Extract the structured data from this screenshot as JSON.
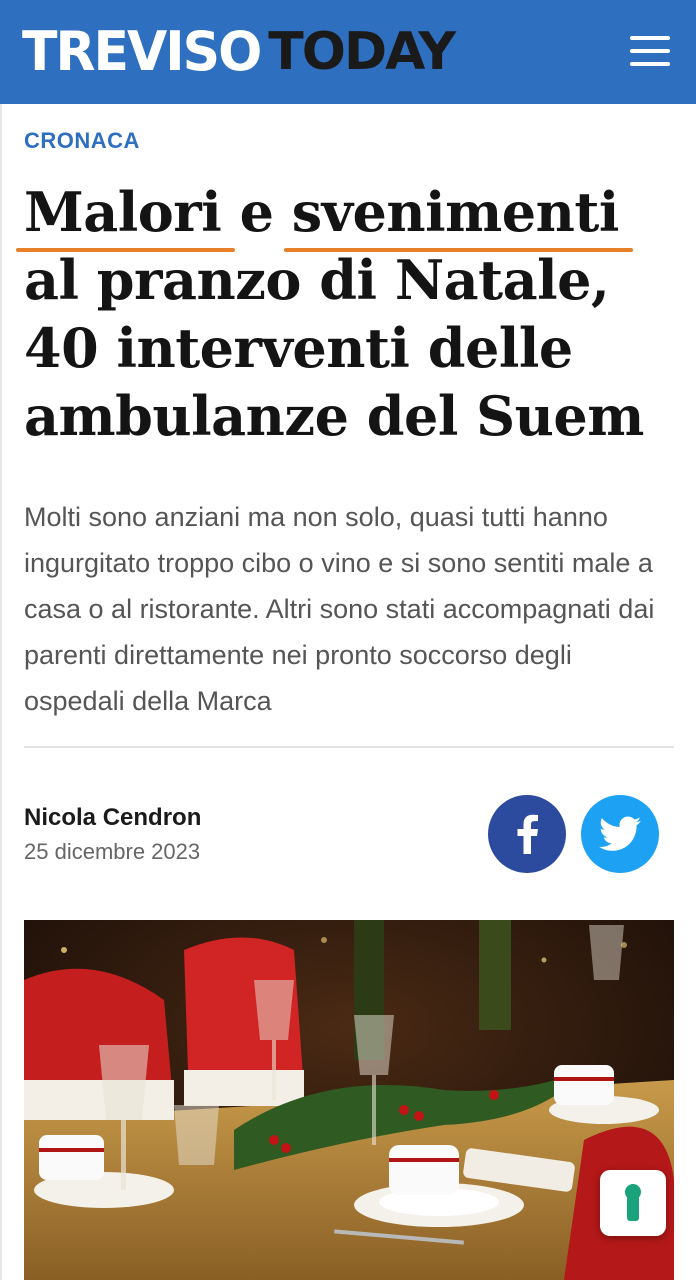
{
  "header": {
    "logo_part1": "TREVISO",
    "logo_part2": "TODAY",
    "brand_color": "#2f6fbf"
  },
  "article": {
    "category": "CRONACA",
    "headline": {
      "word1": "Malori",
      "conj": "e",
      "word2": "svenimenti",
      "line2": "al pranzo di Natale,",
      "line3": "40 interventi delle",
      "line4": "ambulanze del Suem"
    },
    "subtitle": "Molti sono anziani ma non solo, quasi tutti hanno ingurgitato troppo cibo o vino e si sono sentiti male a casa o al ristorante. Altri sono stati accompagnati dai parenti direttamente nei pronto soccorso degli ospedali della Marca",
    "author": "Nicola Cendron",
    "date": "25 dicembre 2023"
  },
  "share": {
    "facebook_icon": "facebook-icon",
    "twitter_icon": "twitter-icon",
    "facebook_color": "#2c4a9e",
    "twitter_color": "#1da1f2"
  },
  "privacy_badge": {
    "icon": "keyhole-icon",
    "color": "#1aa37a"
  },
  "colors": {
    "highlight_underline": "#e8802a",
    "category": "#2f6fbf"
  }
}
